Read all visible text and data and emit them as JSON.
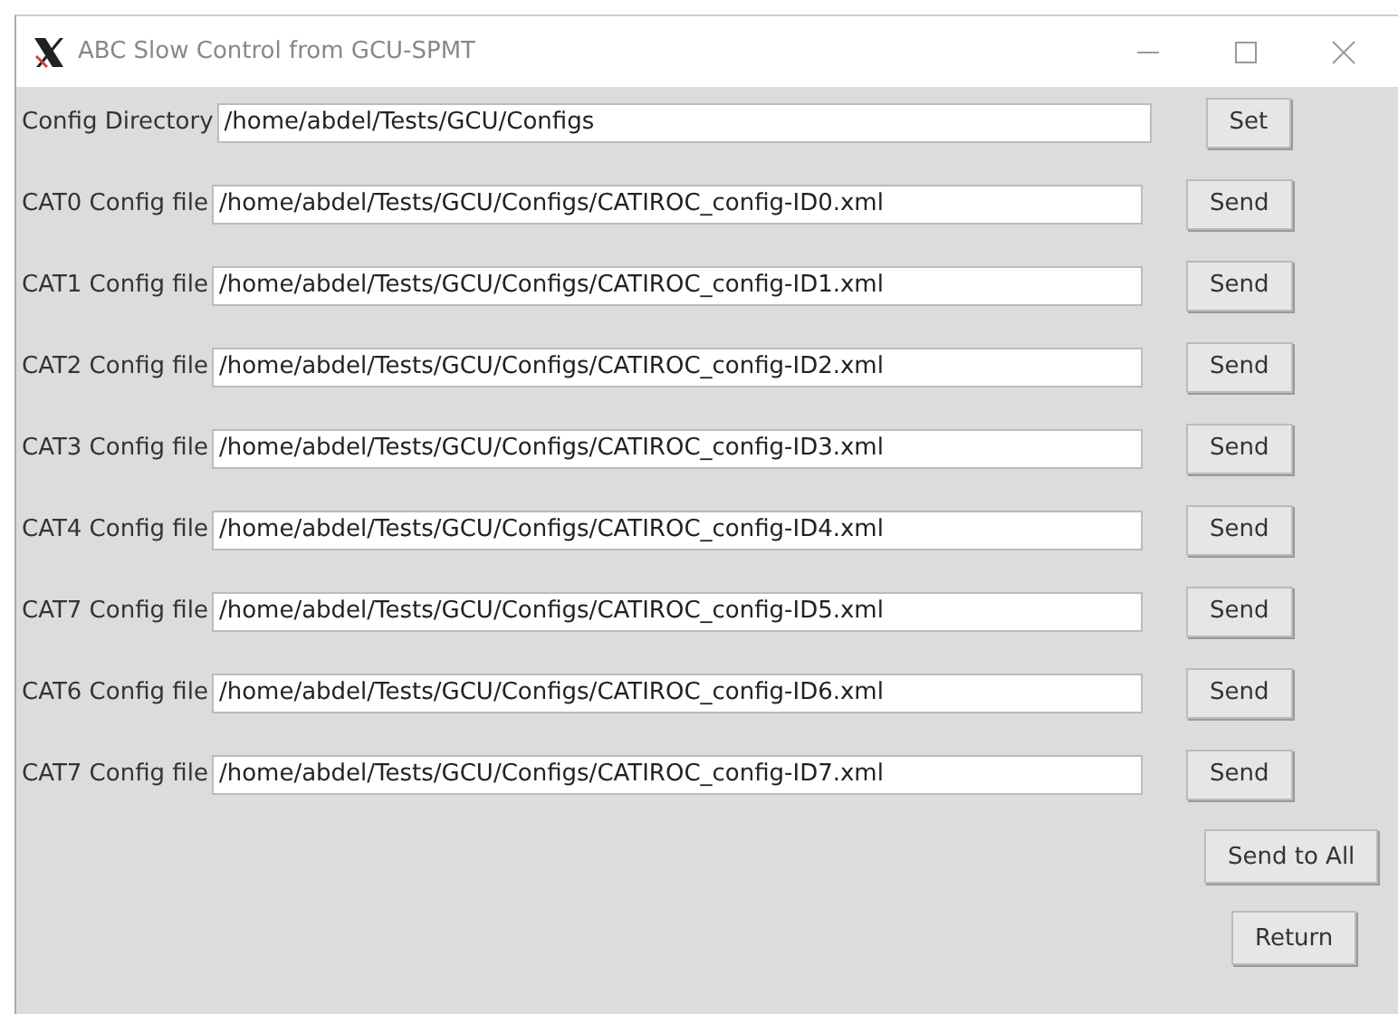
{
  "window": {
    "title": "ABC Slow Control from GCU-SPMT"
  },
  "directory": {
    "label": "Config Directory",
    "value": "/home/abdel/Tests/GCU/Configs",
    "button": "Set"
  },
  "files": [
    {
      "label": "CAT0 Config file",
      "value": "/home/abdel/Tests/GCU/Configs/CATIROC_config-ID0.xml",
      "button": "Send"
    },
    {
      "label": "CAT1 Config file",
      "value": "/home/abdel/Tests/GCU/Configs/CATIROC_config-ID1.xml",
      "button": "Send"
    },
    {
      "label": "CAT2 Config file",
      "value": "/home/abdel/Tests/GCU/Configs/CATIROC_config-ID2.xml",
      "button": "Send"
    },
    {
      "label": "CAT3 Config file",
      "value": "/home/abdel/Tests/GCU/Configs/CATIROC_config-ID3.xml",
      "button": "Send"
    },
    {
      "label": "CAT4 Config file",
      "value": "/home/abdel/Tests/GCU/Configs/CATIROC_config-ID4.xml",
      "button": "Send"
    },
    {
      "label": "CAT7 Config file",
      "value": "/home/abdel/Tests/GCU/Configs/CATIROC_config-ID5.xml",
      "button": "Send"
    },
    {
      "label": "CAT6 Config file",
      "value": "/home/abdel/Tests/GCU/Configs/CATIROC_config-ID6.xml",
      "button": "Send"
    },
    {
      "label": "CAT7 Config file",
      "value": "/home/abdel/Tests/GCU/Configs/CATIROC_config-ID7.xml",
      "button": "Send"
    }
  ],
  "buttons": [
    "Send to All",
    "Return"
  ]
}
